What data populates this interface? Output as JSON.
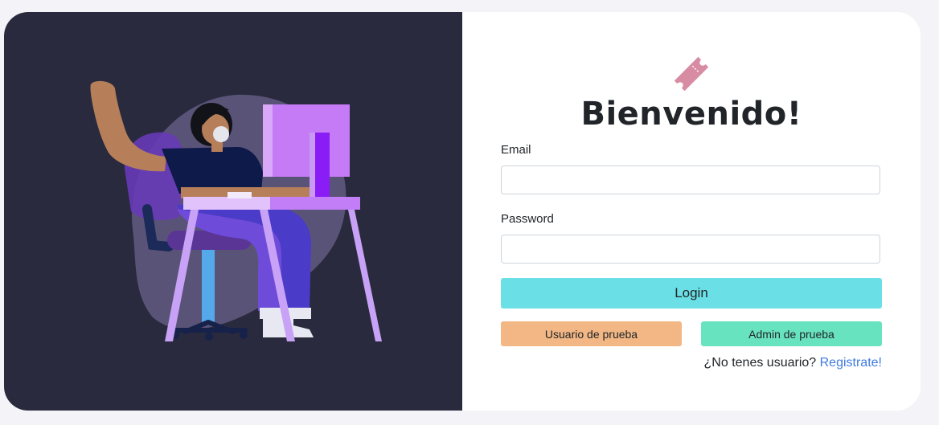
{
  "colors": {
    "left_panel_bg": "#292a3d",
    "login_button": "#6adfe5",
    "test_user_button": "#f2b784",
    "test_admin_button": "#68e3bf",
    "link": "#3d7ae0",
    "ticket_icon": "#d88ca3"
  },
  "icons": {
    "logo": "ticket-icon",
    "illustration": "woman-at-computer-illustration"
  },
  "login": {
    "title": "Bienvenido!",
    "email_label": "Email",
    "email_value": "",
    "password_label": "Password",
    "password_value": "",
    "login_label": "Login",
    "test_user_label": "Usuario de prueba",
    "test_admin_label": "Admin de prueba",
    "register_prompt": "¿No tenes usuario?",
    "register_link": "Registrate!"
  }
}
